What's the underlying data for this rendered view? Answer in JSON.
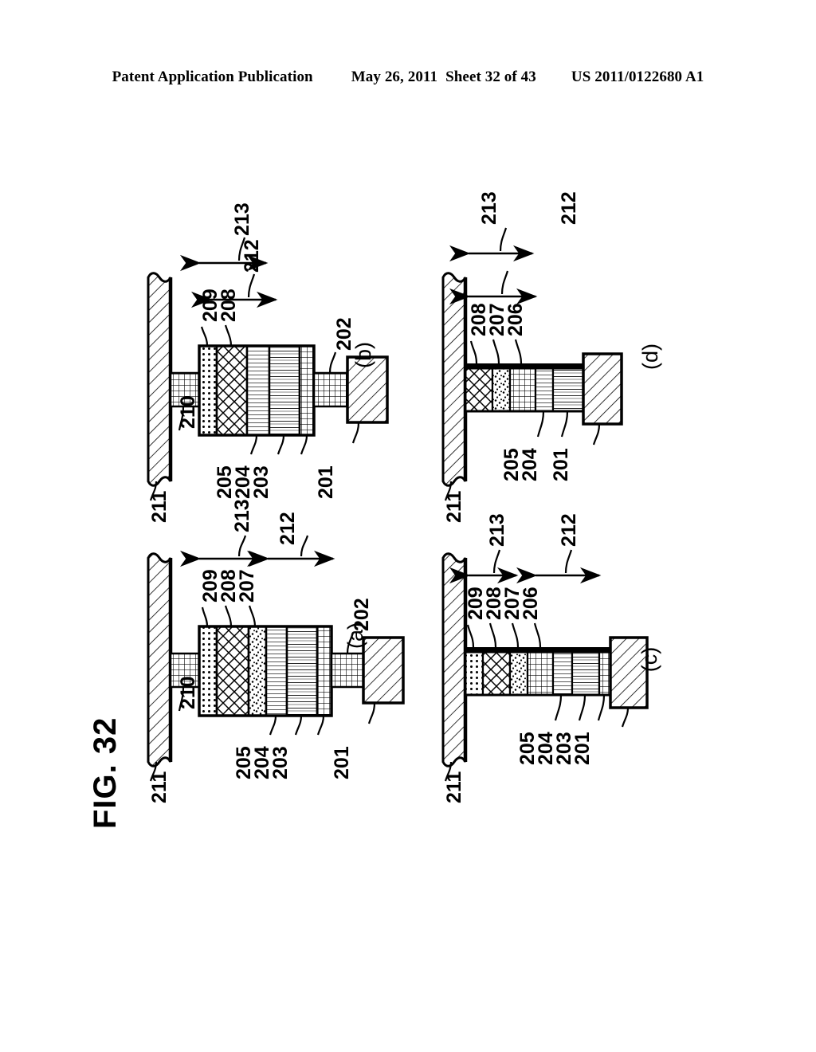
{
  "header": {
    "publication": "Patent Application Publication",
    "date": "May 26, 2011",
    "sheet": "Sheet 32 of 43",
    "patent_number": "US 2011/0122680 A1"
  },
  "figure": {
    "title": "FIG. 32",
    "type": "patent-drawing",
    "description": "Four cross-sectional views (a)-(d) of a layered memory-cell stack on a substrate"
  },
  "panels": [
    {
      "id": "a",
      "letter": "(a)",
      "substrate_label": "211",
      "top_labels": [
        "209",
        "208",
        "207"
      ],
      "via_label": "210",
      "bottom_labels": [
        "205",
        "204",
        "203"
      ],
      "electrode_label": "202",
      "base_label": "201",
      "dimension_labels": [
        "213",
        "212"
      ],
      "layers": [
        "209",
        "208",
        "207",
        "205",
        "204",
        "203"
      ],
      "layer_patterns": [
        "dots-vertical",
        "diamond-cross",
        "stipple",
        "fine-vertical",
        "horizontal-lines",
        "grid"
      ]
    },
    {
      "id": "b",
      "letter": "(b)",
      "substrate_label": "211",
      "top_labels": [
        "209",
        "208"
      ],
      "via_label": "210",
      "bottom_labels": [
        "205",
        "204",
        "203"
      ],
      "electrode_label": "202",
      "base_label": "201",
      "dimension_labels": [
        "213",
        "212"
      ],
      "layers": [
        "209",
        "208",
        "205",
        "204",
        "203"
      ],
      "layer_patterns": [
        "dots-vertical",
        "diamond-cross",
        "fine-vertical",
        "horizontal-lines",
        "grid"
      ]
    },
    {
      "id": "c",
      "letter": "(c)",
      "substrate_label": "211",
      "top_labels": [
        "209",
        "208",
        "207",
        "206"
      ],
      "bottom_labels": [
        "205",
        "204",
        "203",
        "201"
      ],
      "dimension_labels": [
        "213",
        "212"
      ],
      "layers": [
        "209",
        "208",
        "207",
        "206",
        "205",
        "204",
        "203"
      ],
      "layer_patterns": [
        "dots-vertical",
        "diamond-cross",
        "stipple",
        "grid",
        "fine-vertical",
        "horizontal-lines",
        "grid"
      ]
    },
    {
      "id": "d",
      "letter": "(d)",
      "substrate_label": "211",
      "top_labels": [
        "208",
        "207",
        "206"
      ],
      "bottom_labels": [
        "205",
        "204",
        "201"
      ],
      "dimension_labels": [
        "213",
        "212"
      ],
      "layers": [
        "208",
        "207",
        "206",
        "205",
        "204"
      ],
      "layer_patterns": [
        "diamond-cross",
        "stipple",
        "grid",
        "fine-vertical",
        "horizontal-lines"
      ]
    }
  ],
  "colors": {
    "ink": "#000000",
    "paper": "#ffffff"
  }
}
